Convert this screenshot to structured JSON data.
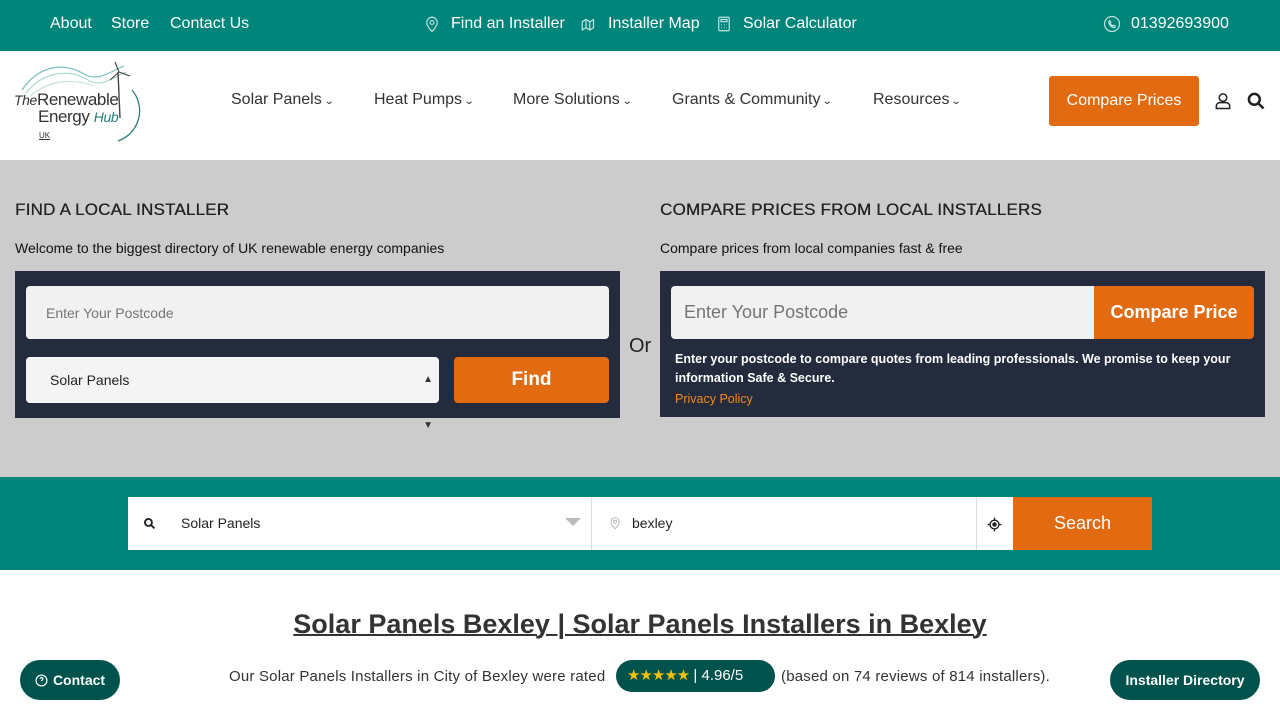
{
  "topbar": {
    "links": [
      "About",
      "Store",
      "Contact Us"
    ],
    "find_installer": "Find an Installer",
    "installer_map": "Installer Map",
    "solar_calculator": "Solar Calculator",
    "phone": "01392693900"
  },
  "logo": {
    "the": "The",
    "renewable": "Renewable",
    "energy": "Energy",
    "hub": "Hub",
    "uk": "UK"
  },
  "nav": {
    "items": [
      "Solar Panels",
      "Heat Pumps",
      "More Solutions",
      "Grants & Community",
      "Resources"
    ],
    "compare_prices": "Compare Prices"
  },
  "find_local": {
    "title": "FIND A LOCAL INSTALLER",
    "subtitle": "Welcome to the biggest directory of UK renewable energy companies",
    "postcode_placeholder": "Enter Your Postcode",
    "category_selected": "Solar Panels",
    "find_label": "Find"
  },
  "or_label": "Or",
  "compare": {
    "title": "COMPARE PRICES FROM LOCAL INSTALLERS",
    "subtitle": "Compare prices from local companies fast & free",
    "postcode_placeholder": "Enter Your Postcode",
    "button_label": "Compare Price",
    "note": "Enter your postcode to compare quotes from leading professionals. We promise to keep your information Safe & Secure.",
    "privacy": "Privacy Policy"
  },
  "searchbar": {
    "category": "Solar Panels",
    "location": "bexley",
    "search_label": "Search"
  },
  "page": {
    "title": "Solar Panels Bexley | Solar Panels Installers in Bexley",
    "rating_prefix": "Our Solar Panels Installers in City of Bexley were rated",
    "rating_stars": "★★★★★",
    "rating_value": "| 4.96/5",
    "rating_suffix": "(based on 74 reviews of 814 installers)."
  },
  "floating": {
    "contact": "Contact",
    "directory": "Installer Directory"
  },
  "colors": {
    "teal": "#00857b",
    "dark_teal": "#00524c",
    "orange": "#e26b12",
    "navy": "#232b3c",
    "grey": "#cccccc"
  }
}
